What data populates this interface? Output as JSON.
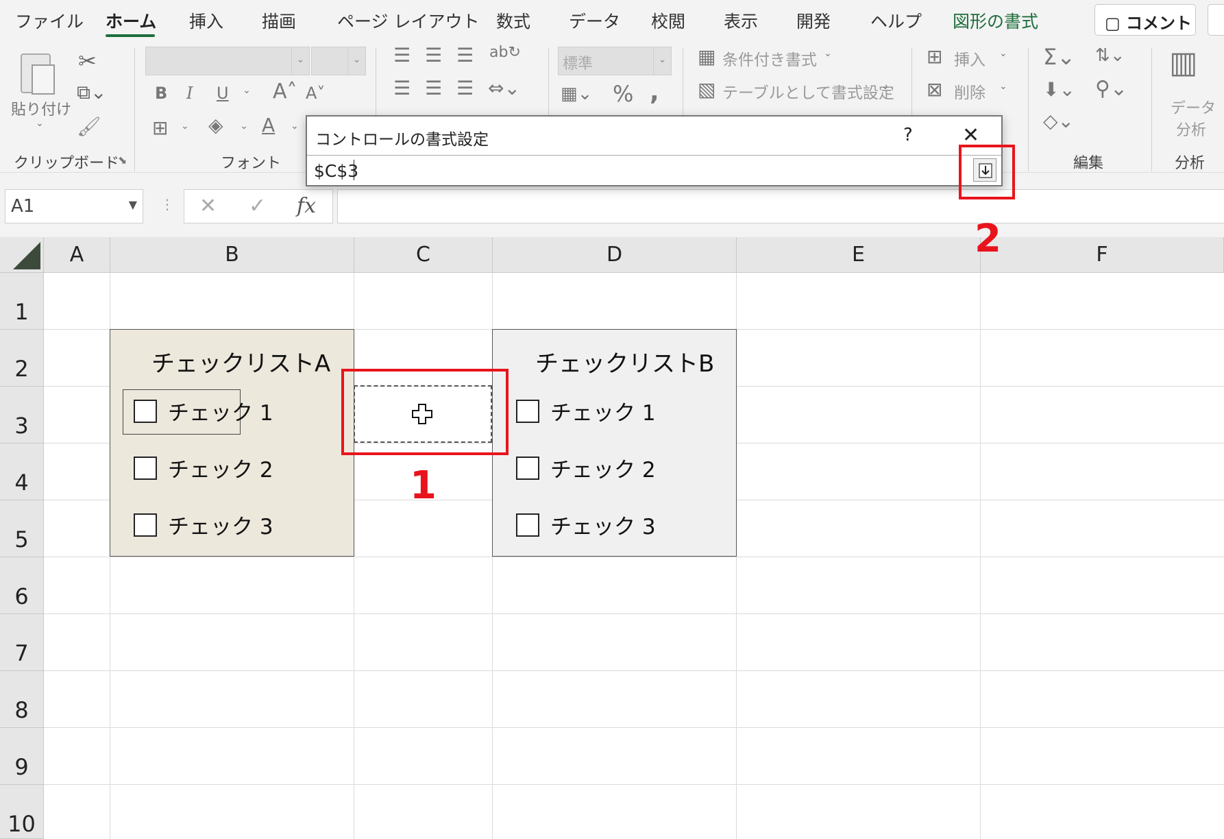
{
  "tabs": [
    {
      "label": "ファイル",
      "active": false
    },
    {
      "label": "ホーム",
      "active": true
    },
    {
      "label": "挿入",
      "active": false
    },
    {
      "label": "描画",
      "active": false
    },
    {
      "label": "ページ レイアウト",
      "active": false
    },
    {
      "label": "数式",
      "active": false
    },
    {
      "label": "データ",
      "active": false
    },
    {
      "label": "校閲",
      "active": false
    },
    {
      "label": "表示",
      "active": false
    },
    {
      "label": "開発",
      "active": false
    },
    {
      "label": "ヘルプ",
      "active": false
    },
    {
      "label": "図形の書式",
      "active": false
    }
  ],
  "comment_button": "コメント",
  "ribbon": {
    "paste": "貼り付け",
    "clipboard": "クリップボード",
    "font": "フォント",
    "number_format": "標準",
    "conditional_format": "条件付き書式",
    "table_format": "テーブルとして書式設定",
    "insert": "挿入",
    "delete": "削除",
    "edit": "編集",
    "data_analysis_1": "データ",
    "data_analysis_2": "分析",
    "analysis": "分析"
  },
  "formula_bar": {
    "name_box": "A1"
  },
  "grid": {
    "columns": [
      "A",
      "B",
      "C",
      "D",
      "E",
      "F"
    ],
    "rows": [
      "1",
      "2",
      "3",
      "4",
      "5",
      "6",
      "7",
      "8",
      "9",
      "10"
    ]
  },
  "checklist_a": {
    "title": "チェックリストA",
    "items": [
      "チェック 1",
      "チェック 2",
      "チェック 3"
    ]
  },
  "checklist_b": {
    "title": "チェックリストB",
    "items": [
      "チェック 1",
      "チェック 2",
      "チェック 3"
    ]
  },
  "dialog": {
    "title": "コントロールの書式設定",
    "help": "?",
    "input_value": "$C$3"
  },
  "annotations": {
    "step1": "1",
    "step2": "2"
  },
  "colors": {
    "accent": "#1e6e3d",
    "highlight_red": "#e8141c",
    "checklist_a_bg": "#ede8dc",
    "checklist_b_bg": "#f0f0f0"
  }
}
